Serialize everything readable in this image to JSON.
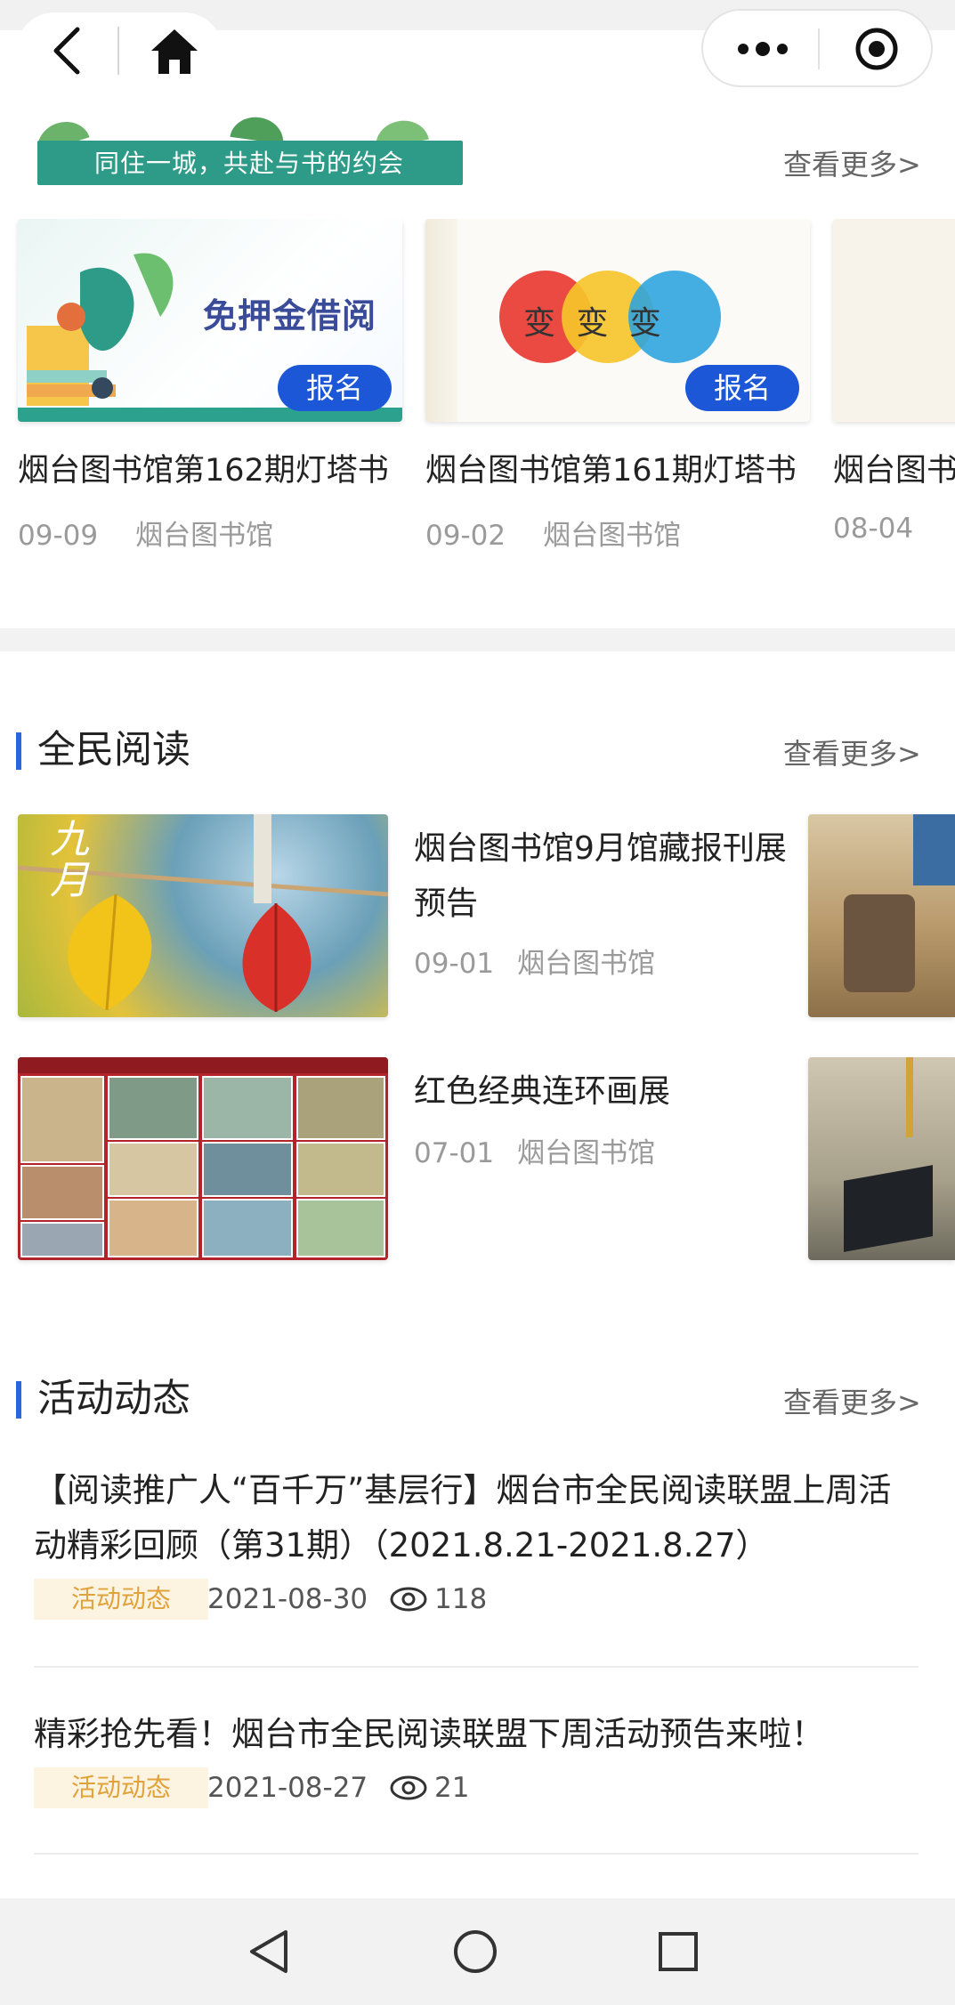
{
  "header": {
    "back_icon": "chevron-left-icon",
    "home_icon": "home-icon",
    "more_icon": "more-dots-icon",
    "target_icon": "target-icon"
  },
  "banner": {
    "title": "同住一城，共赴与书的约会",
    "see_more": "查看更多>",
    "cards": [
      {
        "image_text": "免押金借阅",
        "button": "报名",
        "title": "烟台图书馆第162期灯塔书",
        "date": "09-09",
        "org": "烟台图书馆"
      },
      {
        "image_text": "变 变 变",
        "button": "报名",
        "title": "烟台图书馆第161期灯塔书",
        "date": "09-02",
        "org": "烟台图书馆"
      },
      {
        "title": "烟台图书",
        "date": "08-04"
      }
    ]
  },
  "reading": {
    "title": "全民阅读",
    "see_more": "查看更多>",
    "items": [
      {
        "title": "烟台图书馆9月馆藏报刊展预告",
        "date": "09-01",
        "org": "烟台图书馆",
        "image_text": "九月"
      },
      {
        "title": "红色经典连环画展",
        "date": "07-01",
        "org": "烟台图书馆"
      }
    ]
  },
  "activity": {
    "title": "活动动态",
    "see_more": "查看更多>",
    "items": [
      {
        "title": "【阅读推广人“百千万”基层行】烟台市全民阅读联盟上周活动精彩回顾（第31期）（2021.8.21-2021.8.27）",
        "tag": "活动动态",
        "date": "2021-08-30",
        "views": "118"
      },
      {
        "title": "精彩抢先看！烟台市全民阅读联盟下周活动预告来啦！",
        "tag": "活动动态",
        "date": "2021-08-27",
        "views": "21"
      }
    ]
  },
  "colors": {
    "accent": "#1b57d6",
    "section_bar": "#2a66e0",
    "banner_green": "#2e9a88",
    "tag_bg": "#fdf3e1",
    "tag_text": "#e0a23b"
  }
}
